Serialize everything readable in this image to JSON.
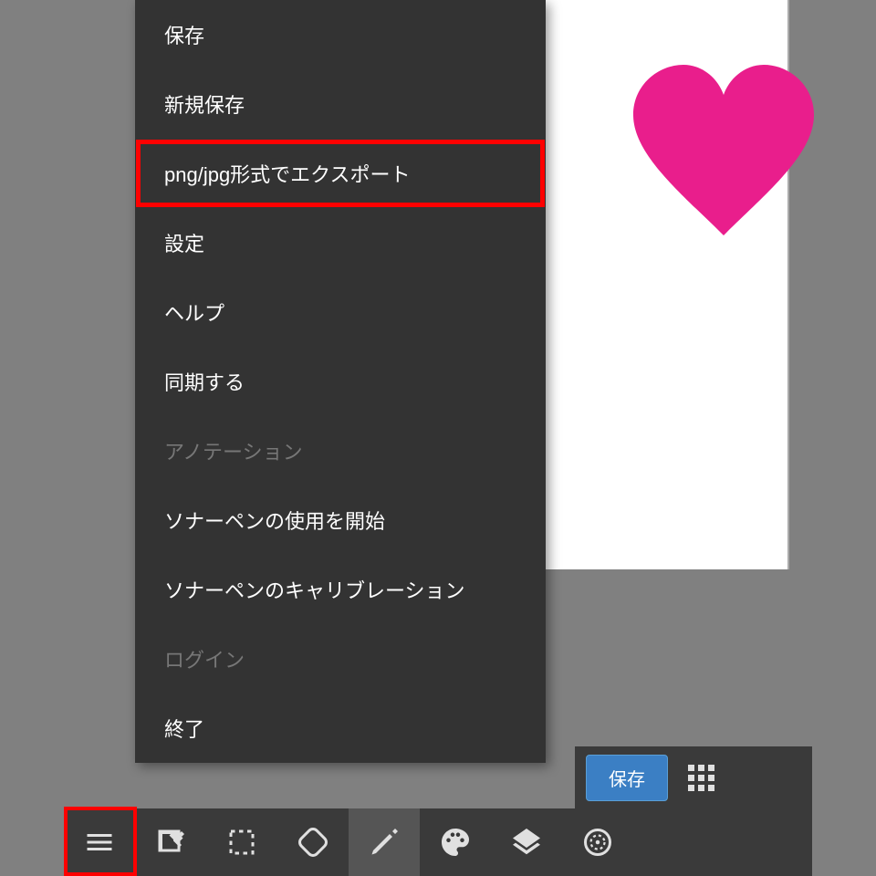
{
  "menu": {
    "items": [
      {
        "label": "保存",
        "enabled": true,
        "highlighted": false
      },
      {
        "label": "新規保存",
        "enabled": true,
        "highlighted": false
      },
      {
        "label": "png/jpg形式でエクスポート",
        "enabled": true,
        "highlighted": true
      },
      {
        "label": "設定",
        "enabled": true,
        "highlighted": false
      },
      {
        "label": "ヘルプ",
        "enabled": true,
        "highlighted": false
      },
      {
        "label": "同期する",
        "enabled": true,
        "highlighted": false
      },
      {
        "label": "アノテーション",
        "enabled": false,
        "highlighted": false
      },
      {
        "label": "ソナーペンの使用を開始",
        "enabled": true,
        "highlighted": false
      },
      {
        "label": "ソナーペンのキャリブレーション",
        "enabled": true,
        "highlighted": false
      },
      {
        "label": "ログイン",
        "enabled": false,
        "highlighted": false
      },
      {
        "label": "終了",
        "enabled": true,
        "highlighted": false
      }
    ]
  },
  "savebar": {
    "save_label": "保存"
  },
  "toolbar": {
    "icons": [
      "menu-icon",
      "edit-frame-icon",
      "selection-icon",
      "rotate-icon",
      "pencil-icon",
      "palette-icon",
      "layers-icon",
      "target-icon"
    ],
    "active_index": 4,
    "highlighted_index": 0
  },
  "canvas": {
    "shape": "heart",
    "color": "#e91e8c"
  }
}
